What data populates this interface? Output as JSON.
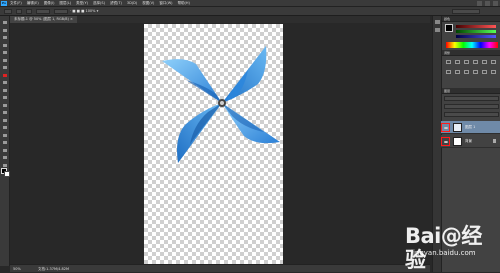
{
  "app": {
    "logo_text": "Ps",
    "menus": [
      "文件(F)",
      "编辑(E)",
      "图像(I)",
      "图层(L)",
      "类型(Y)",
      "选择(S)",
      "滤镜(T)",
      "3D(D)",
      "视图(V)",
      "窗口(W)",
      "帮助(H)"
    ]
  },
  "options_bar": {
    "text": "· ■ ■ ■  100%  ▾"
  },
  "document": {
    "tab_label": "未标题-1 @ 50% (图层 1, RGB/8) ×"
  },
  "statusbar": {
    "zoom": "50%",
    "doc_info": "文档:1.37M/4.82M"
  },
  "tools": [
    {
      "name": "move-tool",
      "active": false
    },
    {
      "name": "marquee-tool",
      "active": false
    },
    {
      "name": "lasso-tool",
      "active": false
    },
    {
      "name": "quick-select-tool",
      "active": false
    },
    {
      "name": "crop-tool",
      "active": false
    },
    {
      "name": "eyedropper-tool",
      "active": false
    },
    {
      "name": "healing-brush-tool",
      "active": false
    },
    {
      "name": "brush-tool",
      "active": true
    },
    {
      "name": "clone-stamp-tool",
      "active": false
    },
    {
      "name": "history-brush-tool",
      "active": false
    },
    {
      "name": "eraser-tool",
      "active": false
    },
    {
      "name": "gradient-tool",
      "active": false
    },
    {
      "name": "blur-tool",
      "active": false
    },
    {
      "name": "dodge-tool",
      "active": false
    },
    {
      "name": "pen-tool",
      "active": false
    },
    {
      "name": "type-tool",
      "active": false
    },
    {
      "name": "path-select-tool",
      "active": false
    },
    {
      "name": "shape-tool",
      "active": false
    },
    {
      "name": "hand-tool",
      "active": false
    },
    {
      "name": "zoom-tool",
      "active": false
    }
  ],
  "panels": {
    "color_title": "颜色",
    "adjust_title": "调整",
    "layers_title": "图层",
    "layers": [
      {
        "name": "图层 1",
        "selected": true,
        "has_lock": false
      },
      {
        "name": "背景",
        "selected": false,
        "has_lock": true
      }
    ]
  },
  "watermark": {
    "big": "Bai@经验",
    "small": "jingyan.baidu.com"
  },
  "colors": {
    "pinwheel_main": "#3a8fe0",
    "pinwheel_light": "#7ec4f6",
    "eye_highlight": "#ff1a1a",
    "layer_selected": "#6f8aa8"
  }
}
